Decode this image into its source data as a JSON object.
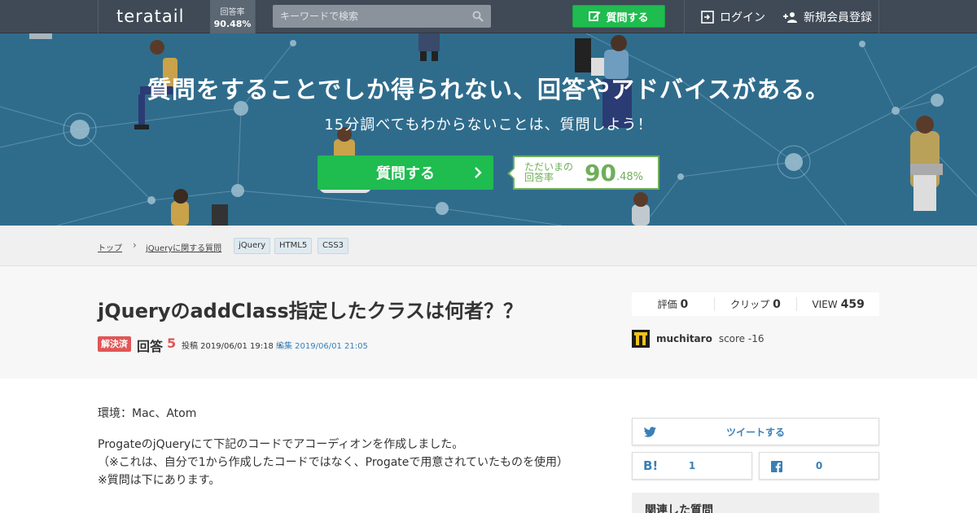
{
  "nav": {
    "logo": "teratail",
    "rate_label": "回答率",
    "rate_value": "90.48%",
    "search_placeholder": "キーワードで検索",
    "ask_button": "質問する",
    "login": "ログイン",
    "signup": "新規会員登録"
  },
  "hero": {
    "title": "質問をすることでしか得られない、回答やアドバイスがある。",
    "subtitle": "15分調べてもわからないことは、質問しよう！",
    "ask_button": "質問する",
    "rate_label_1": "ただいまの",
    "rate_label_2": "回答率",
    "rate_big": "90",
    "rate_small": ".48%"
  },
  "breadcrumb": {
    "top": "トップ",
    "sep": "›",
    "category": "jQueryに関する質問",
    "tags": [
      "jQuery",
      "HTML5",
      "CSS3"
    ]
  },
  "question": {
    "title": "jQueryのaddClass指定したクラスは何者？？",
    "status": "解決済",
    "answers_label": "回答",
    "answers_count": "5",
    "posted": "投稿 2019/06/01 19:18 ・",
    "edited": "編集 2019/06/01 21:05",
    "stats": {
      "rating_label": "評価",
      "rating_value": "0",
      "clip_label": "クリップ",
      "clip_value": "0",
      "view_label": "VIEW",
      "view_value": "459"
    },
    "user": {
      "name": "muchitaro",
      "score": "score -16"
    }
  },
  "body": {
    "line1": "環境：Mac、Atom",
    "line2": "ProgateのjQueryにて下記のコードでアコーディオンを作成しました。",
    "line3": "（※これは、自分で1から作成したコードではなく、Progateで用意されていたものを使用）",
    "line4": "※質問は下にあります。"
  },
  "share": {
    "tweet": "ツイートする",
    "hatena_count": "1",
    "facebook_count": "0"
  },
  "sidebar": {
    "related_title": "関連した質問"
  },
  "colors": {
    "nav_bg": "#3f4a56",
    "hero_bg": "#2f6c8c",
    "green": "#1fbc4f",
    "red": "#e15656",
    "rate_green": "#6fae5a"
  }
}
